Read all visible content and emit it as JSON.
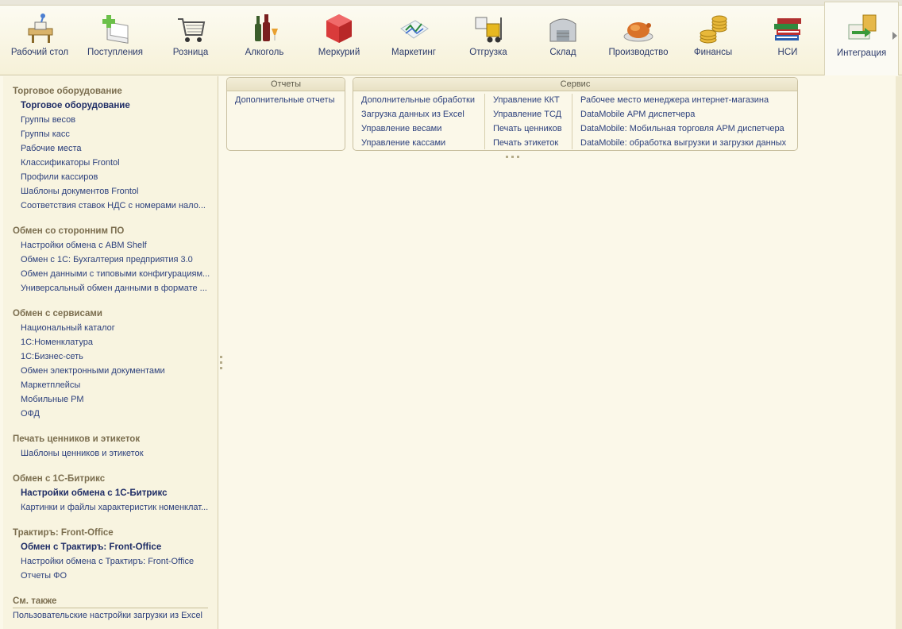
{
  "sections": [
    {
      "label": "Рабочий стол",
      "icon": "desk-icon"
    },
    {
      "label": "Поступления",
      "icon": "receipts-icon"
    },
    {
      "label": "Розница",
      "icon": "cart-icon"
    },
    {
      "label": "Алкоголь",
      "icon": "bottles-icon"
    },
    {
      "label": "Меркурий",
      "icon": "mercury-cube-icon"
    },
    {
      "label": "Маркетинг",
      "icon": "marketing-chart-icon"
    },
    {
      "label": "Отгрузка",
      "icon": "forklift-icon"
    },
    {
      "label": "Склад",
      "icon": "warehouse-icon"
    },
    {
      "label": "Производство",
      "icon": "roast-chicken-icon"
    },
    {
      "label": "Финансы",
      "icon": "coins-icon"
    },
    {
      "label": "НСИ",
      "icon": "books-icon"
    },
    {
      "label": "Интеграция",
      "icon": "integration-icon"
    }
  ],
  "active_section": "Интеграция",
  "sidebar": {
    "groups": [
      {
        "title": "Торговое оборудование",
        "items": [
          {
            "label": "Торговое оборудование",
            "bold": true
          },
          {
            "label": "Группы весов"
          },
          {
            "label": "Группы касс"
          },
          {
            "label": "Рабочие места"
          },
          {
            "label": "Классификаторы Frontol"
          },
          {
            "label": "Профили кассиров"
          },
          {
            "label": "Шаблоны документов Frontol"
          },
          {
            "label": "Соответствия ставок НДС с номерами нало..."
          }
        ]
      },
      {
        "title": "Обмен со сторонним ПО",
        "items": [
          {
            "label": "Настройки обмена с ABM Shelf"
          },
          {
            "label": "Обмен с 1С: Бухгалтерия предприятия 3.0"
          },
          {
            "label": "Обмен данными с типовыми конфигурациям..."
          },
          {
            "label": "Универсальный обмен данными в формате ..."
          }
        ]
      },
      {
        "title": "Обмен с сервисами",
        "items": [
          {
            "label": "Национальный каталог"
          },
          {
            "label": "1С:Номенклатура"
          },
          {
            "label": "1С:Бизнес-сеть"
          },
          {
            "label": "Обмен электронными документами"
          },
          {
            "label": "Маркетплейсы"
          },
          {
            "label": "Мобильные РМ"
          },
          {
            "label": "ОФД"
          }
        ]
      },
      {
        "title": "Печать ценников и этикеток",
        "items": [
          {
            "label": "Шаблоны ценников и этикеток"
          }
        ]
      },
      {
        "title": "Обмен с 1С-Битрикс",
        "items": [
          {
            "label": "Настройки обмена с 1С-Битрикс",
            "bold": true
          },
          {
            "label": "Картинки и файлы характеристик номенклат..."
          }
        ]
      },
      {
        "title": "Трактиръ: Front-Office",
        "items": [
          {
            "label": "Обмен с Трактиръ: Front-Office",
            "bold": true
          },
          {
            "label": "Настройки обмена с Трактиръ: Front-Office"
          },
          {
            "label": "Отчеты ФО"
          }
        ]
      }
    ],
    "see_also": {
      "title": "См. также",
      "items": [
        {
          "label": "Пользовательские настройки загрузки из Excel"
        }
      ]
    }
  },
  "reports_panel": {
    "title": "Отчеты",
    "items": [
      "Дополнительные отчеты"
    ]
  },
  "service_panel": {
    "title": "Сервис",
    "columns": [
      [
        "Дополнительные обработки",
        "Загрузка данных из Excel",
        "Управление весами",
        "Управление кассами"
      ],
      [
        "Управление ККТ",
        "Управление ТСД",
        "Печать ценников",
        "Печать этикеток"
      ],
      [
        "Рабочее место менеджера интернет-магазина",
        "DataMobile АРМ диспетчера",
        "DataMobile: Мобильная торговля АРМ диспетчера",
        "DataMobile: обработка выгрузки и загрузки данных"
      ]
    ]
  }
}
